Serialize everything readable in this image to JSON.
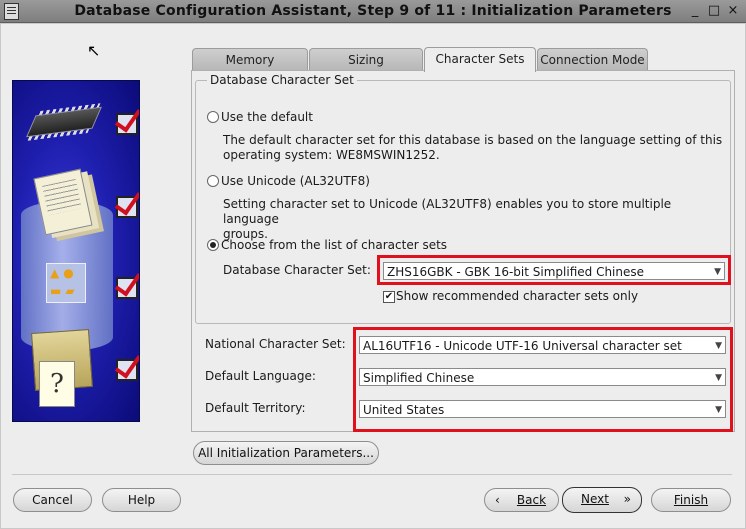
{
  "window": {
    "title": "Database Configuration Assistant, Step 9 of 11 : Initialization Parameters",
    "controls": {
      "minimize": "_",
      "maximize": "□",
      "close": "×"
    }
  },
  "tabs": [
    {
      "label": "Memory"
    },
    {
      "label": "Sizing"
    },
    {
      "label": "Character Sets",
      "active": true
    },
    {
      "label": "Connection Mode"
    }
  ],
  "db_charset": {
    "legend": "Database Character Set",
    "option_default": {
      "label": "Use the default",
      "desc1": "The default character set for this database is based on the language setting of this",
      "desc2": "operating system: WE8MSWIN1252.",
      "selected": false
    },
    "option_unicode": {
      "label": "Use Unicode (AL32UTF8)",
      "desc1": "Setting character set to Unicode (AL32UTF8) enables you to store multiple language",
      "desc2": "groups.",
      "selected": false
    },
    "option_list": {
      "label": "Choose from the list of character sets",
      "selected": true
    },
    "charset_label": "Database Character Set:",
    "charset_value": "ZHS16GBK - GBK 16-bit Simplified Chinese",
    "recommended_label": "Show recommended character sets only",
    "recommended_checked": true
  },
  "national": {
    "label": "National Character Set:",
    "value": "AL16UTF16 - Unicode UTF-16 Universal character set"
  },
  "language": {
    "label": "Default Language:",
    "value": "Simplified Chinese"
  },
  "territory": {
    "label": "Default Territory:",
    "value": "United States"
  },
  "buttons": {
    "all_params": "All Initialization Parameters...",
    "cancel": "Cancel",
    "help": "Help",
    "back": "Back",
    "next": "Next",
    "finish": "Finish"
  },
  "icons": {
    "back": "‹",
    "next": "»",
    "dropdown": "▼",
    "check": "✔"
  },
  "colors": {
    "highlight": "#e0101c",
    "graphic_bg": "#1f1fb0"
  }
}
